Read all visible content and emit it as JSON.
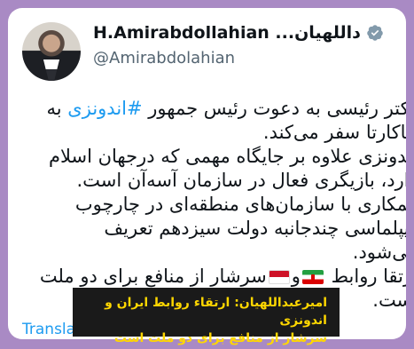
{
  "profile": {
    "display_name": "H.Amirabdollahian ...داللهیان",
    "handle": "@Amirabdolahian",
    "verified_icon": "verified-badge-icon"
  },
  "tweet": {
    "line1_prefix": "دکتر رئیسی به دعوت رئیس جمهور ",
    "hashtag": "#اندونزی",
    "line1_suffix": " به",
    "line2": "جاکارتا سفر می‌کند.",
    "line3": "اندونزی علاوه بر جایگاه مهمی که درجهان اسلام",
    "line4": "دارد، بازیگری فعال در سازمان آسه‌آن است.",
    "line5": "همکاری با سازمان‌های منطقه‌ای در چارچوب",
    "line6": "دیپلماسی چندجانبه دولت سیزدهم تعریف",
    "line7": "می‌شود.",
    "line8_prefix": "ارتقا روابط",
    "line8_mid": "و",
    "line8_suffix": "سرشار از منافع برای دو ملت",
    "line9": "است."
  },
  "translate_label": "Transla",
  "caption": {
    "line1": "امیرعبداللهیان: ارتقاء روابط ایران و اندونزی",
    "line2": "سرشار از منافع برای دو ملت است"
  },
  "colors": {
    "frame": "#a98ac4",
    "hashtag": "#1d9bf0",
    "caption_bg": "#1a1a1a",
    "caption_text": "#ffd700",
    "verified": "#829aab"
  }
}
